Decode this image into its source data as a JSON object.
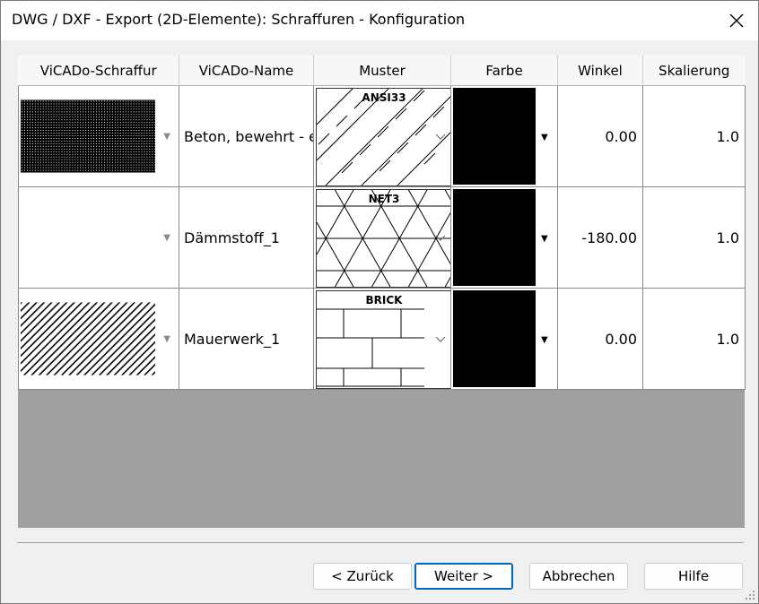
{
  "window": {
    "title": "DWG / DXF - Export (2D-Elemente): Schraffuren - Konfiguration"
  },
  "table": {
    "columns": [
      "ViCADo-Schraffur",
      "ViCADo-Name",
      "Muster",
      "Farbe",
      "Winkel",
      "Skalierung"
    ],
    "rows": [
      {
        "vicado_hatch": "crosshatch-dense",
        "name": "Beton, bewehrt - ebene",
        "muster": "ANSI33",
        "farbe": "#000000",
        "winkel": "0.00",
        "skalierung": "1.0"
      },
      {
        "vicado_hatch": "empty",
        "name": "Dämmstoff_1",
        "muster": "NET3",
        "farbe": "#000000",
        "winkel": "-180.00",
        "skalierung": "1.0"
      },
      {
        "vicado_hatch": "diagonal-lines",
        "name": "Mauerwerk_1",
        "muster": "BRICK",
        "farbe": "#000000",
        "winkel": "0.00",
        "skalierung": "1.0"
      }
    ]
  },
  "buttons": {
    "back": "< Zurück",
    "next": "Weiter >",
    "cancel": "Abbrechen",
    "help": "Hilfe"
  },
  "icons": {
    "close": "close-icon",
    "dropdown": "chevron-down-icon",
    "triangle": "triangle-down-icon"
  },
  "colors": {
    "grid_background": "#a0a0a0",
    "default_button_border": "#0067c0"
  }
}
